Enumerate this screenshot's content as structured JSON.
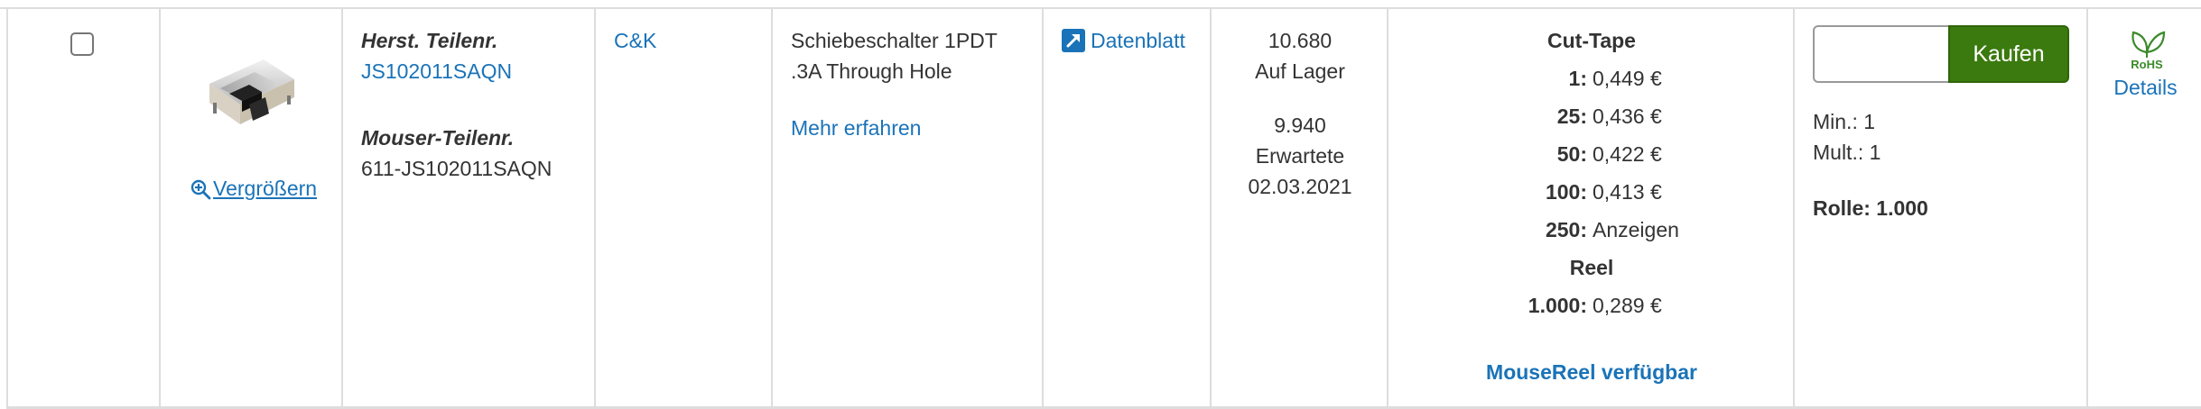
{
  "row": {
    "select": {
      "checked": false
    },
    "image": {
      "alt": "product-image",
      "zoom_label": "Vergrößern"
    },
    "partnums": {
      "mfr_label": "Herst. Teilenr.",
      "mfr_number": "JS102011SAQN",
      "mouser_label": "Mouser-Teilenr.",
      "mouser_number": "611-JS102011SAQN"
    },
    "manufacturer": "C&K",
    "description": {
      "line1": "Schiebeschalter 1PDT",
      "line2": ".3A Through Hole",
      "more": "Mehr erfahren"
    },
    "datasheet": {
      "label": "Datenblatt",
      "icon": "external-link-icon"
    },
    "availability": {
      "in_stock_qty": "10.680",
      "in_stock_label": "Auf Lager",
      "expected_qty": "9.940",
      "expected_label": "Erwartete",
      "expected_date": "02.03.2021"
    },
    "pricing": {
      "cut_tape_label": "Cut-Tape",
      "breaks": [
        {
          "qty": "1:",
          "price": "0,449 €"
        },
        {
          "qty": "25:",
          "price": "0,436 €"
        },
        {
          "qty": "50:",
          "price": "0,422 €"
        },
        {
          "qty": "100:",
          "price": "0,413 €"
        },
        {
          "qty": "250:",
          "price": "Anzeigen"
        }
      ],
      "reel_label": "Reel",
      "reel_break": {
        "qty": "1.000:",
        "price": "0,289 €"
      },
      "mousereel": "MouseReel verfügbar"
    },
    "purchase": {
      "qty_value": "",
      "buy_label": "Kaufen",
      "min": "Min.: 1",
      "mult": "Mult.: 1",
      "roll": "Rolle: 1.000"
    },
    "compliance": {
      "rohs_text": "RoHS",
      "details_label": "Details"
    },
    "colors": {
      "link": "#1a73b8",
      "buy_button": "#3b7a0f",
      "rohs": "#3a8a2a"
    }
  }
}
